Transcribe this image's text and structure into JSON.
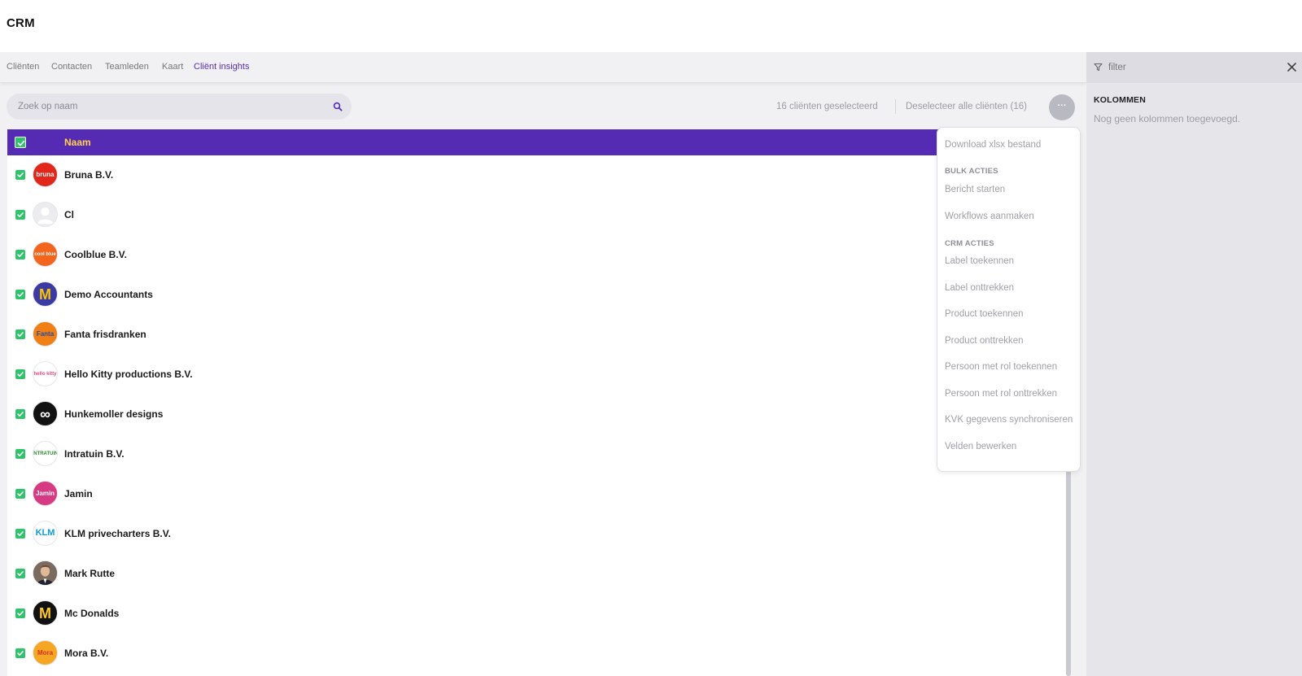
{
  "app": {
    "title": "CRM"
  },
  "tabs": [
    {
      "label": "Cliënten"
    },
    {
      "label": "Contacten"
    },
    {
      "label": "Teamleden"
    },
    {
      "label": "Kaart"
    },
    {
      "label": "Cliënt insights"
    }
  ],
  "search": {
    "placeholder": "Zoek op naam"
  },
  "toolbar": {
    "selected_count": "16 cliënten geselecteerd",
    "deselect_label": "Deselecteer alle cliënten (16)",
    "more_label": "···"
  },
  "table": {
    "header": "Naam",
    "rows": [
      {
        "name": "Bruna B.V.",
        "avatar": "bruna",
        "avatar_text": "bruna",
        "bg": "#e2261c",
        "fg": "#ffffff"
      },
      {
        "name": "Cl",
        "avatar": "person-placeholder",
        "avatar_text": "",
        "bg": "#ececef",
        "fg": "#ffffff"
      },
      {
        "name": "Coolblue B.V.",
        "avatar": "coolblue",
        "avatar_text": "cool blue",
        "bg": "#f3651c",
        "fg": "#ffffff"
      },
      {
        "name": "Demo Accountants",
        "avatar": "demo-accountants",
        "avatar_text": "M",
        "bg": "#3b3aa3",
        "fg": "#f6c400"
      },
      {
        "name": "Fanta frisdranken",
        "avatar": "fanta",
        "avatar_text": "Fanta",
        "bg": "#f07f16",
        "fg": "#1c4fa4"
      },
      {
        "name": "Hello Kitty productions B.V.",
        "avatar": "hello-kitty",
        "avatar_text": "hello kitty",
        "bg": "#ffffff",
        "fg": "#e5457b"
      },
      {
        "name": "Hunkemoller designs",
        "avatar": "hunkemoller",
        "avatar_text": "∞",
        "bg": "#111111",
        "fg": "#ffffff"
      },
      {
        "name": "Intratuin B.V.",
        "avatar": "intratuin",
        "avatar_text": "INTRATUIN",
        "bg": "#ffffff",
        "fg": "#2b8a2f"
      },
      {
        "name": "Jamin",
        "avatar": "jamin",
        "avatar_text": "Jamin",
        "bg": "#d63a83",
        "fg": "#ffffff"
      },
      {
        "name": "KLM privecharters B.V.",
        "avatar": "klm",
        "avatar_text": "KLM",
        "bg": "#ffffff",
        "fg": "#0a9fda"
      },
      {
        "name": "Mark Rutte",
        "avatar": "person-photo",
        "avatar_text": "",
        "bg": "#6a5548",
        "fg": "#ffffff"
      },
      {
        "name": "Mc Donalds",
        "avatar": "mcdonalds",
        "avatar_text": "M",
        "bg": "#111111",
        "fg": "#ffc72c"
      },
      {
        "name": "Mora B.V.",
        "avatar": "mora",
        "avatar_text": "Mora",
        "bg": "#f5a623",
        "fg": "#d6301f"
      }
    ]
  },
  "dropdown": {
    "download": "Download xlsx bestand",
    "bulk_title": "BULK ACTIES",
    "bulk_items": [
      "Bericht starten",
      "Workflows aanmaken"
    ],
    "crm_title": "CRM ACTIES",
    "crm_items": [
      "Label toekennen",
      "Label onttrekken",
      "Product toekennen",
      "Product onttrekken",
      "Persoon met rol toekennen",
      "Persoon met rol onttrekken",
      "KVK gegevens synchroniseren",
      "Velden bewerken"
    ]
  },
  "side_panel": {
    "filter_label": "filter",
    "columns_title": "KOLOMMEN",
    "columns_empty": "Nog geen kolommen toegevoegd."
  },
  "colors": {
    "accent": "#552bb4",
    "header_text": "#ffd24a",
    "check": "#2fc46c",
    "active_tab": "#5b2db5"
  }
}
